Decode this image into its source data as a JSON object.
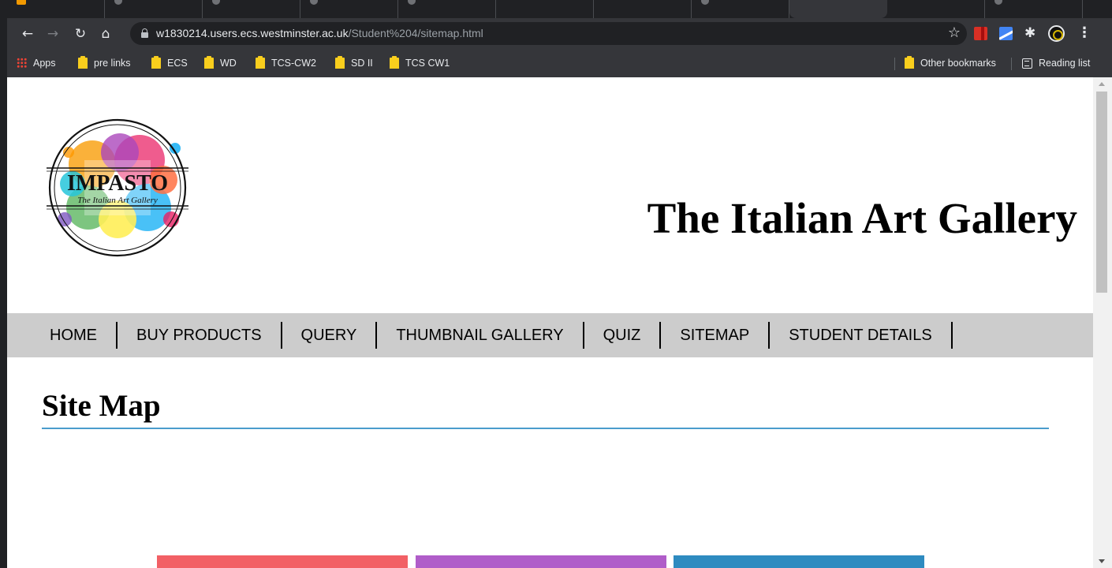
{
  "browser": {
    "url_host": "w1830214.users.ecs.westminster.ac.uk",
    "url_path": "/Student%204/sitemap.html",
    "bookmarks": [
      {
        "label": "Apps",
        "icon": "apps-grid-icon"
      },
      {
        "label": "pre links",
        "icon": "folder-icon"
      },
      {
        "label": "ECS",
        "icon": "folder-icon"
      },
      {
        "label": "WD",
        "icon": "folder-icon"
      },
      {
        "label": "TCS-CW2",
        "icon": "folder-icon"
      },
      {
        "label": "SD II",
        "icon": "folder-icon"
      },
      {
        "label": "TCS CW1",
        "icon": "folder-icon"
      }
    ],
    "other_bookmarks": "Other bookmarks",
    "reading_list": "Reading list"
  },
  "site": {
    "logo": {
      "name": "IMPASTO",
      "tagline": "The Italian Art Gallery"
    },
    "title": "The Italian Art Gallery",
    "nav": [
      "HOME",
      "BUY PRODUCTS",
      "QUERY",
      "THUMBNAIL GALLERY",
      "QUIZ",
      "SITEMAP",
      "STUDENT DETAILS"
    ],
    "heading": "Site Map",
    "tile_colors": [
      "#f26065",
      "#b05dc9",
      "#2e8bc0"
    ]
  }
}
